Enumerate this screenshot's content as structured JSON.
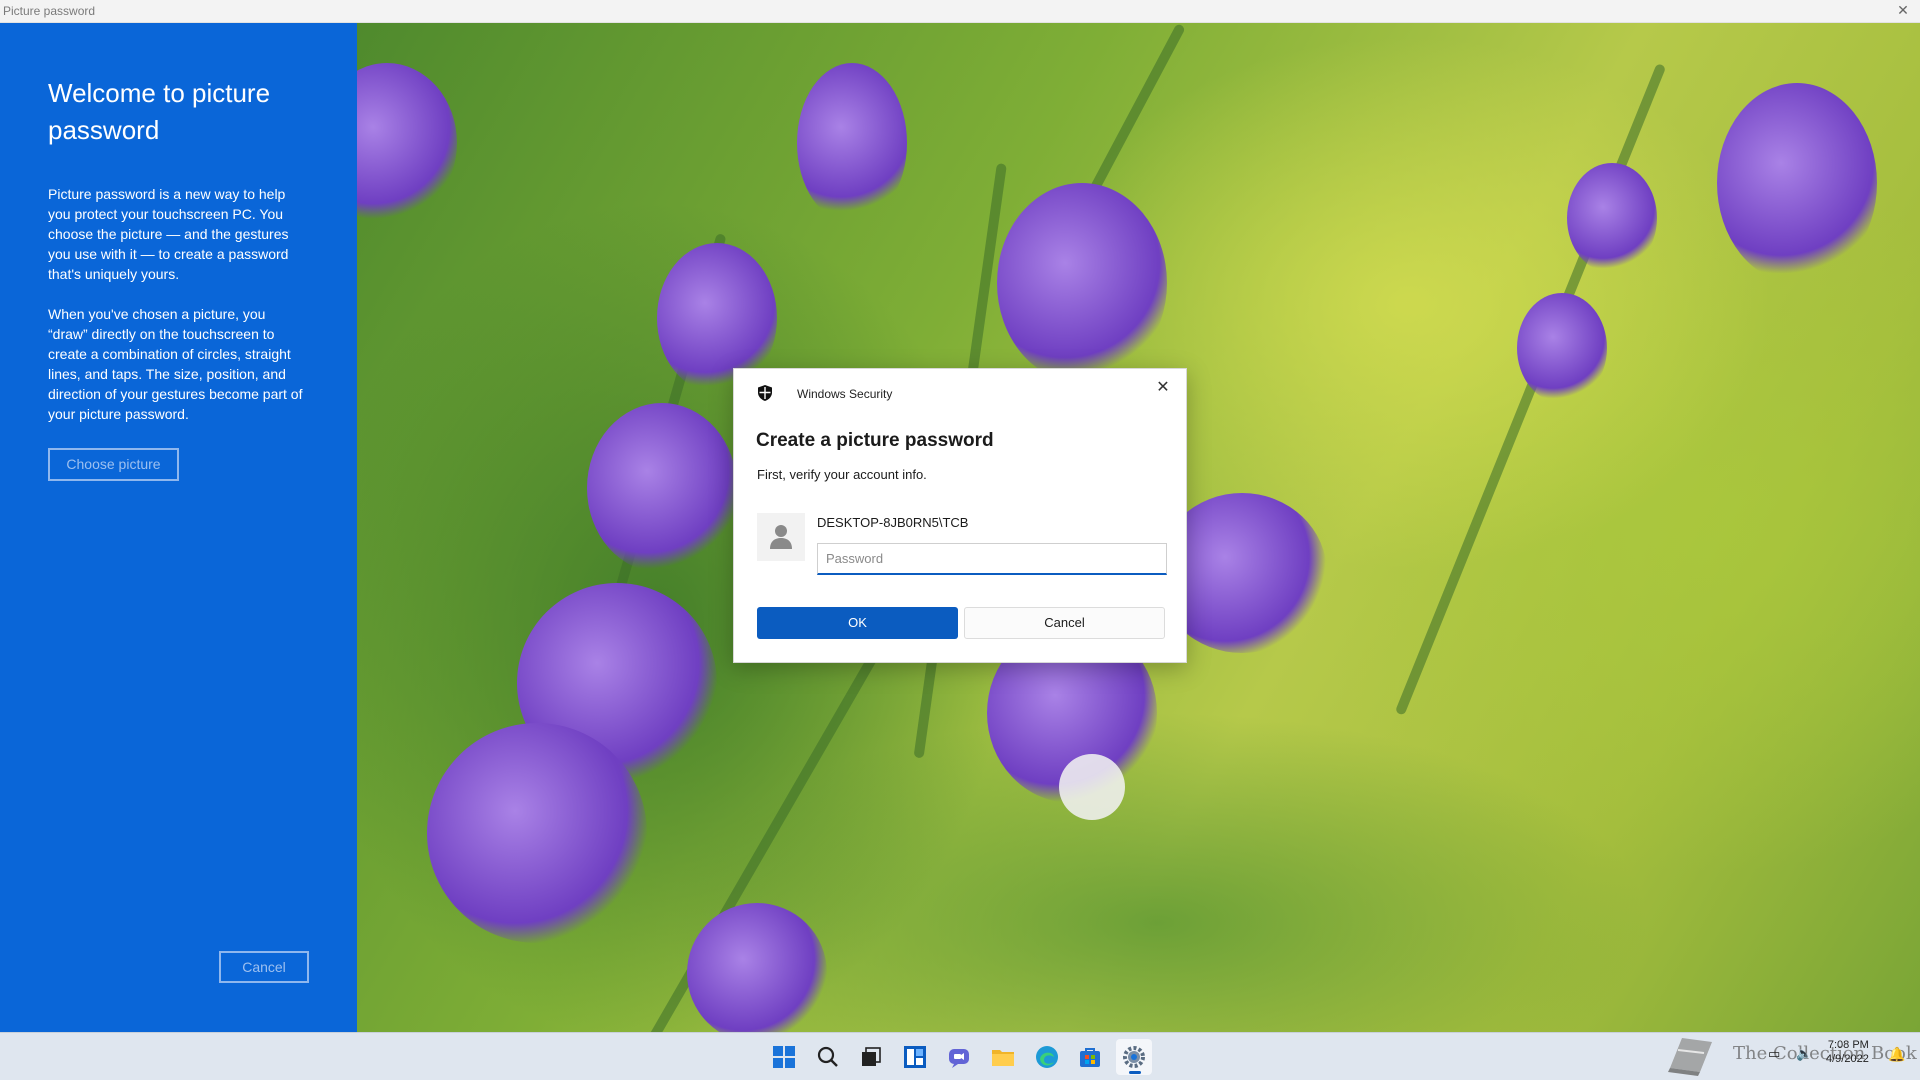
{
  "window": {
    "title": "Picture password"
  },
  "left_panel": {
    "heading": "Welcome to picture password",
    "paragraph1": "Picture password is a new way to help you protect your touchscreen PC. You choose the picture — and the gestures you use with it — to create a password that's uniquely yours.",
    "paragraph2": "When you've chosen a picture, you “draw” directly on the touchscreen to create a combination of circles, straight lines, and taps. The size, position, and direction of your gestures become part of your picture password.",
    "choose_button": "Choose picture",
    "cancel_button": "Cancel"
  },
  "dialog": {
    "title": "Windows Security",
    "heading": "Create a picture password",
    "subtitle": "First, verify your account info.",
    "account": "DESKTOP-8JB0RN5\\TCB",
    "password_placeholder": "Password",
    "password_value": "",
    "ok_button": "OK",
    "cancel_button": "Cancel",
    "accent_color": "#0b5cc0"
  },
  "taskbar": {
    "icons": [
      "start-icon",
      "search-icon",
      "task-view-icon",
      "widgets-icon",
      "chat-icon",
      "file-explorer-icon",
      "edge-icon",
      "store-icon",
      "settings-icon"
    ],
    "active": "settings-icon",
    "watermark": "The Collection Book",
    "time": "7:08 PM",
    "date": "4/9/2022"
  },
  "colors": {
    "panel_blue": "#0a66d8",
    "taskbar_bg": "#dfe6ef"
  }
}
